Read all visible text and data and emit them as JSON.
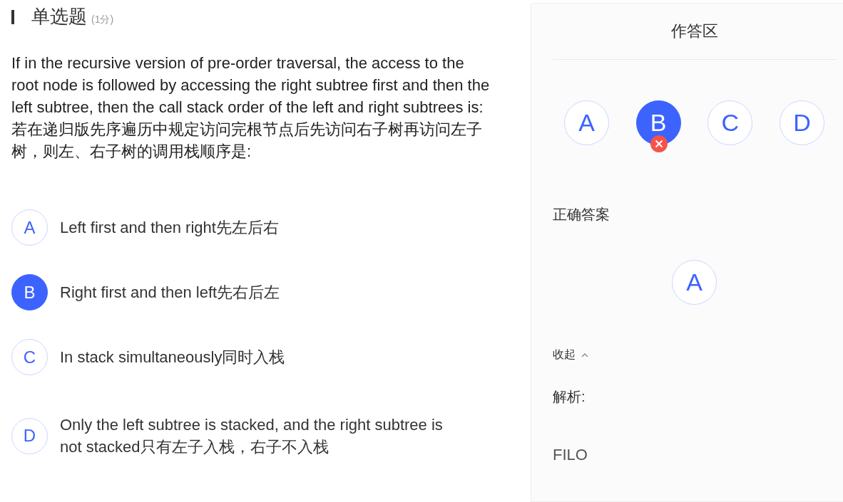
{
  "question": {
    "type": "单选题",
    "score": "(1分)",
    "text": "If in the recursive version of pre-order traversal, the access to the root node is followed by accessing the right subtree first and then the left subtree, then the call stack order of the left and right subtrees is: 若在递归版先序遍历中规定访问完根节点后先访问右子树再访问左子树，则左、右子树的调用栈顺序是:",
    "options": [
      {
        "letter": "A",
        "text": "Left first and then right先左后右",
        "selected": false
      },
      {
        "letter": "B",
        "text": "Right first and then left先右后左",
        "selected": true
      },
      {
        "letter": "C",
        "text": "In stack simultaneously同时入栈",
        "selected": false
      },
      {
        "letter": "D",
        "text": "Only the left subtree is stacked, and the right subtree is not stacked只有左子入栈，右子不入栈",
        "selected": false
      }
    ]
  },
  "answer_panel": {
    "title": "作答区",
    "choices": [
      {
        "letter": "A",
        "selected": false,
        "wrong": false
      },
      {
        "letter": "B",
        "selected": true,
        "wrong": true
      },
      {
        "letter": "C",
        "selected": false,
        "wrong": false
      },
      {
        "letter": "D",
        "selected": false,
        "wrong": false
      }
    ],
    "correct_label": "正确答案",
    "correct": [
      "A"
    ],
    "collapse": "收起",
    "analysis_label": "解析:",
    "analysis": "FILO"
  }
}
